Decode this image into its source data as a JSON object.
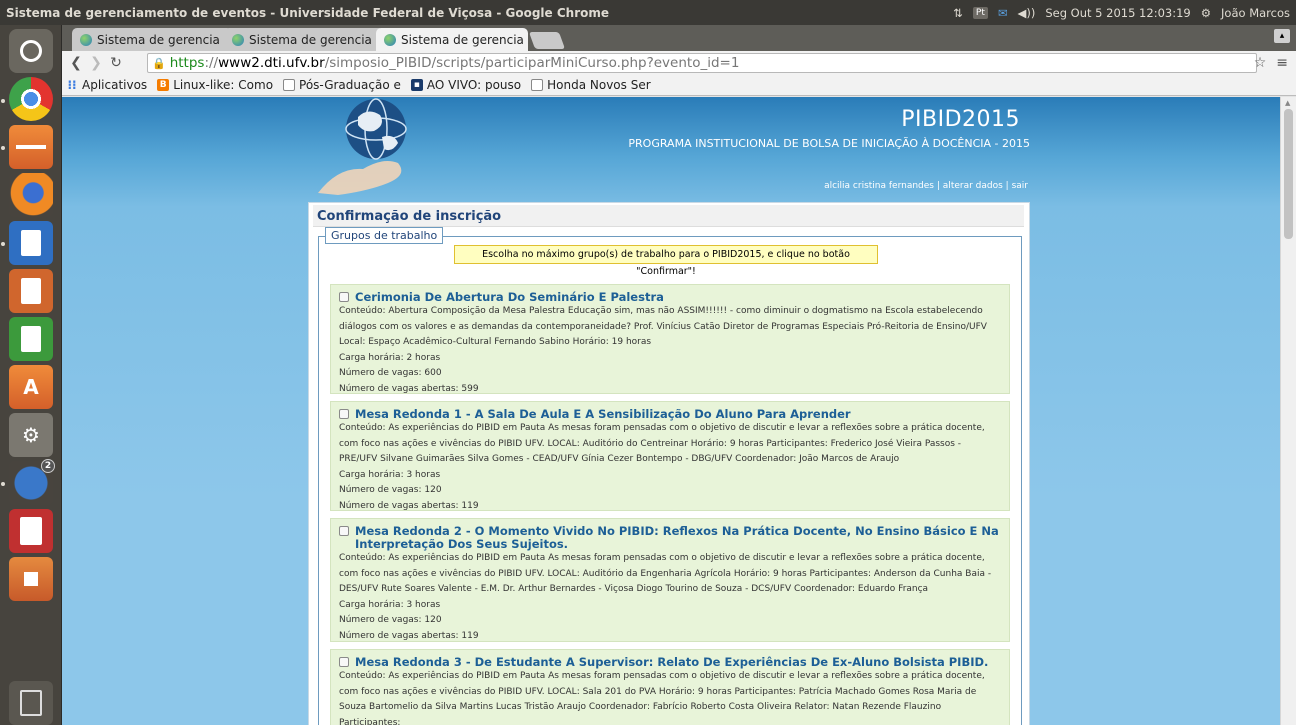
{
  "os": {
    "window_title": "Sistema de gerenciamento de eventos - Universidade Federal de Viçosa - Google Chrome",
    "clock": "Seg Out  5 2015 12:03:19",
    "user": "João Marcos",
    "indicator_pt": "Pt"
  },
  "browser": {
    "tabs": [
      {
        "label": "Sistema de gerencia",
        "close": "×"
      },
      {
        "label": "Sistema de gerencia",
        "close": "×"
      },
      {
        "label": "Sistema de gerencia",
        "close": "×"
      }
    ],
    "url": {
      "scheme": "https",
      "sep": "://",
      "host": "www2.dti.ufv.br",
      "path": "/simposio_PIBID/scripts/participarMiniCurso.php?evento_id=1"
    },
    "bookmarks": [
      {
        "label": "Aplicativos"
      },
      {
        "label": "Linux-like: Como"
      },
      {
        "label": "Pós-Graduação e"
      },
      {
        "label": "AO VIVO: pouso"
      },
      {
        "label": "Honda Novos Ser"
      }
    ]
  },
  "site": {
    "name": "PIBID2015",
    "subtitle": "PROGRAMA INSTITUCIONAL DE BOLSA DE INICIAÇÃO À DOCÊNCIA - 2015",
    "user_name": "alcilia cristina fernandes",
    "sep": "|",
    "edit_link": "alterar dados",
    "logout_link": "sair"
  },
  "page": {
    "title": "Confirmação de inscrição",
    "legend": "Grupos de trabalho",
    "notice": "Escolha no máximo grupo(s) de trabalho para o PIBID2015, e clique no botão \"Confirmar\"!"
  },
  "events": [
    {
      "title": "Cerimonia De Abertura Do Seminário E Palestra",
      "lines": [
        "Conteúdo: Abertura Composição da Mesa Palestra Educação sim, mas não ASSIM!!!!!! - como diminuir o dogmatismo na Escola estabelecendo",
        "diálogos com os valores e as demandas da contemporaneidade? Prof. Vinícius Catão Diretor de Programas Especiais Pró-Reitoria de Ensino/UFV",
        "Local: Espaço Acadêmico-Cultural Fernando Sabino Horário: 19 horas",
        "Carga horária: 2 horas",
        "Número de vagas: 600",
        "Número de vagas abertas: 599"
      ]
    },
    {
      "title": "Mesa Redonda 1 - A Sala De Aula E A Sensibilização Do Aluno Para Aprender",
      "lines": [
        "Conteúdo: As experiências do PIBID em Pauta As mesas foram pensadas com o objetivo de discutir e levar a reflexões sobre a prática docente,",
        "com foco nas ações e vivências do PIBID UFV. LOCAL: Auditório do Centreinar Horário: 9 horas Participantes: Frederico José Vieira Passos -",
        "PRE/UFV Silvane Guimarães Silva Gomes - CEAD/UFV Gínia Cezer Bontempo - DBG/UFV Coordenador: João Marcos de Araujo",
        "Carga horária: 3 horas",
        "Número de vagas: 120",
        "Número de vagas abertas: 119"
      ]
    },
    {
      "title": "Mesa Redonda 2 - O Momento Vivido No PIBID: Reflexos Na Prática Docente, No Ensino Básico E Na Interpretação Dos Seus Sujeitos.",
      "lines": [
        "Conteúdo: As experiências do PIBID em Pauta As mesas foram pensadas com o objetivo de discutir e levar a reflexões sobre a prática docente,",
        "com foco nas ações e vivências do PIBID UFV. LOCAL: Auditório da Engenharia Agrícola Horário: 9 horas Participantes: Anderson da Cunha Baia -",
        "DES/UFV Rute Soares Valente - E.M. Dr. Arthur Bernardes - Viçosa Diogo Tourino de Souza - DCS/UFV Coordenador: Eduardo França",
        "Carga horária: 3 horas",
        "Número de vagas: 120",
        "Número de vagas abertas: 119"
      ]
    },
    {
      "title": "Mesa Redonda 3 - De Estudante A Supervisor: Relato De Experiências De Ex-Aluno Bolsista PIBID.",
      "lines": [
        "Conteúdo: As experiências do PIBID em Pauta As mesas foram pensadas com o objetivo de discutir e levar a reflexões sobre a prática docente,",
        "com foco nas ações e vivências do PIBID UFV. LOCAL: Sala 201 do PVA Horário: 9 horas Participantes: Patrícia Machado Gomes Rosa Maria de",
        "Souza Bartomelio da Silva Martins Lucas Tristão Araujo Coordenador: Fabrício Roberto Costa Oliveira Relator: Natan Rezende Flauzino",
        "Participantes:"
      ]
    }
  ],
  "launcher": {
    "badge": "2",
    "icons": [
      "dash-icon",
      "chrome-icon",
      "files-icon",
      "firefox-icon",
      "writer-icon",
      "impress-icon",
      "calc-icon",
      "software-center-icon",
      "settings-icon",
      "thunderbird-icon",
      "document-viewer-icon",
      "archive-icon",
      "trash-icon"
    ]
  }
}
